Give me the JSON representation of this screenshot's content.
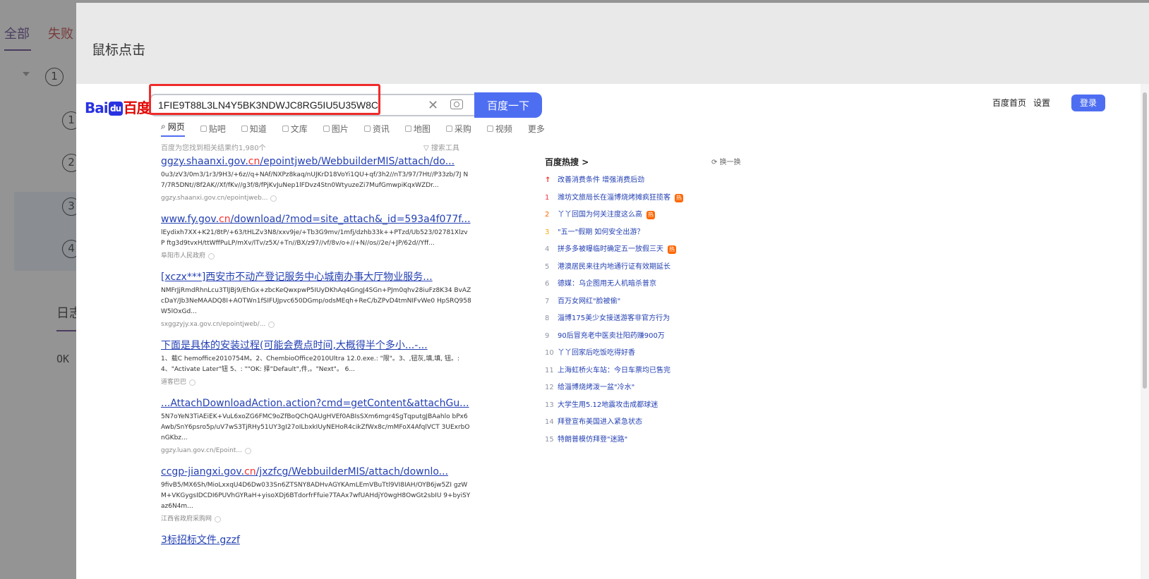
{
  "background": {
    "tabs": [
      "全部",
      "失败"
    ],
    "steps": [
      "1",
      "2",
      "3",
      "4"
    ],
    "log_label": "日志",
    "log_output": "OK"
  },
  "modal": {
    "title": "鼠标点击"
  },
  "baidu": {
    "logo_left": "Bai",
    "logo_right": "百度",
    "logo_paw": "du",
    "search_value": "1FIE9T88L3LN4Y5BK3NDWJC8RG5IU5U35W8C",
    "search_button": "百度一下",
    "top_links": [
      "百度首页",
      "设置"
    ],
    "login": "登录",
    "tabs": [
      {
        "label": "网页",
        "icon": "search-icon"
      },
      {
        "label": "贴吧",
        "icon": "tieba-icon"
      },
      {
        "label": "知道",
        "icon": "zhidao-icon"
      },
      {
        "label": "文库",
        "icon": "wenku-icon"
      },
      {
        "label": "图片",
        "icon": "image-icon"
      },
      {
        "label": "资讯",
        "icon": "news-icon"
      },
      {
        "label": "地图",
        "icon": "map-icon"
      },
      {
        "label": "采购",
        "icon": "purchase-icon"
      },
      {
        "label": "视频",
        "icon": "video-icon"
      },
      {
        "label": "更多",
        "icon": ""
      }
    ],
    "result_count": "百度为您找到相关结果约1,980个",
    "search_tools": "▽ 搜索工具",
    "results": [
      {
        "title_parts": [
          "ggzy.shaanxi.gov.",
          "cn",
          "/epointjweb/WebbuilderMIS/attach/do..."
        ],
        "snippet": "0u3/zV3/0m3/1r3/9H3/+6z//q+NAf/NXPz8kaq/nUJKrD18VoYi1QU+qf/3h2//nT3/97/7Ht//P33zb/7J N7/7R5DNt//8f2AK//Xf/fKv//g3f/8/fPjKvJuNep1lFDvz4Stn0WtyuzeZi7MufGmwpiKqxWZDr...",
        "source": "ggzy.shaanxi.gov.cn/epointjweb..."
      },
      {
        "title_parts": [
          "www.fy.gov.",
          "cn",
          "/download/?mod=site_attach&_id=593a4f077f..."
        ],
        "snippet": "lEydixh7XX+K21/8tP/+63/tHLZv3N8/xxv9je/+Tb3G9mv/1mfj/dzhb33k++PTzd/Ub523/02781XlzvP ftg3d9tvxH/ttWffPuLP/mXv/lTv/z5X/+Tn//BX/z97//vf/8v/o+//+N//os//2e/+JP/62d//Yff...",
        "source": "阜阳市人民政府"
      },
      {
        "title_parts": [
          "[xczx***]西安市不动产登记服务中心城南办事大厅物业服务..."
        ],
        "snippet": "NMFrJjRmdRhnLcu3TlJBj9/EhGx+zbcKeQwxpwP5IUyDKhAq4GngJ4SGn+PJm0qhv28iuFz8K34 BvAZcDaY/Jb3NeMAADQ8I+AOTWn1fSIFUJpvc650DGmp/odsMEqh+ReC/bZPvD4tmNIFvWe0 HpSRQ958W5lOxGd...",
        "source": "sxggzyjy.xa.gov.cn/epointjweb/..."
      },
      {
        "title_parts": [
          "下面是具体的安装过程(可能会费点时间,大概得半个多小...-..."
        ],
        "snippet": "1、载C hemoffice2010754M。2、ChembioOffice2010Ultra 12.0.exe.: \"限\"。3、,钮灰,填,填, 钮。: 4、\"Activate Later\"钮 5、: \"\"OK: 择\"Default\",件,。\"Next\"。 6...",
        "source": "道客巴巴"
      },
      {
        "title_parts": [
          "...AttachDownloadAction.action?cmd=getContent&attachGu..."
        ],
        "snippet": "5N7oYeN3TiAEiEK+VuL6xoZG6FMC9oZfBoQChQAUgHVEf0ABIsSXm6mgr4SgTqputgJBAahlo bPx6Awb/SnY6psro5p/uV7wS3TjRHy51UY3gI27oILbxkIUyNEHoR4cikZfWx8c/mMFoX4AfqlVCT 3UExrbOnGKbz...",
        "source": "ggzy.luan.gov.cn/Epoint..."
      },
      {
        "title_parts": [
          "ccgp-jiangxi.gov.",
          "cn",
          "/jxzfcg/WebbuilderMIS/attach/downlo..."
        ],
        "snippet": "9fivB5/MX6Sh/MioLxxqU4D6Dw033Sn6ZTSNY8ADHvAGYKAmLEmVBuTtl9VI8IAH/OYB6jw5ZI gzWM+VKGygsIDCDI6PUVhGYRaH+yisoXDj6BTdorfrFfuie7TAAx7wfUAHdjY0wgH8OwGt2sbIU 9+byiSYaz6N4m...",
        "source": "江西省政府采购网"
      },
      {
        "title_parts": [
          "3标招标文件.gzzf"
        ],
        "snippet": "",
        "source": ""
      }
    ],
    "hot": {
      "title": "百度热搜",
      "change": "换一换",
      "items": [
        {
          "idx": "",
          "text": "改善消费条件 增强消费后劲",
          "tag": ""
        },
        {
          "idx": "1",
          "text": "潍坊文旅局长在淄博烧烤摊疯狂揽客",
          "tag": "热"
        },
        {
          "idx": "2",
          "text": "丫丫回国为何关注度这么高",
          "tag": "热"
        },
        {
          "idx": "3",
          "text": "\"五一\"假期 如何安全出游？",
          "tag": ""
        },
        {
          "idx": "4",
          "text": "拼多多被曝临时确定五一放假三天",
          "tag": "热"
        },
        {
          "idx": "5",
          "text": "港澳居民来往内地通行证有效期延长",
          "tag": ""
        },
        {
          "idx": "6",
          "text": "德媒：乌企图用无人机暗杀普京",
          "tag": ""
        },
        {
          "idx": "7",
          "text": "百万女网红\"脸被偷\"",
          "tag": ""
        },
        {
          "idx": "8",
          "text": "淄博175美少女接送游客非官方行为",
          "tag": ""
        },
        {
          "idx": "9",
          "text": "90后冒充老中医卖壮阳药赚900万",
          "tag": ""
        },
        {
          "idx": "10",
          "text": "丫丫回家后吃饭吃得好香",
          "tag": ""
        },
        {
          "idx": "11",
          "text": "上海虹桥火车站：今日车票均已售完",
          "tag": ""
        },
        {
          "idx": "12",
          "text": "给淄博烧烤泼一盆\"冷水\"",
          "tag": ""
        },
        {
          "idx": "13",
          "text": "大学生用5.12地震攻击成都球迷",
          "tag": ""
        },
        {
          "idx": "14",
          "text": "拜登宣布美国进入紧急状态",
          "tag": ""
        },
        {
          "idx": "15",
          "text": "特朗普模仿拜登\"迷路\"",
          "tag": ""
        }
      ]
    }
  }
}
